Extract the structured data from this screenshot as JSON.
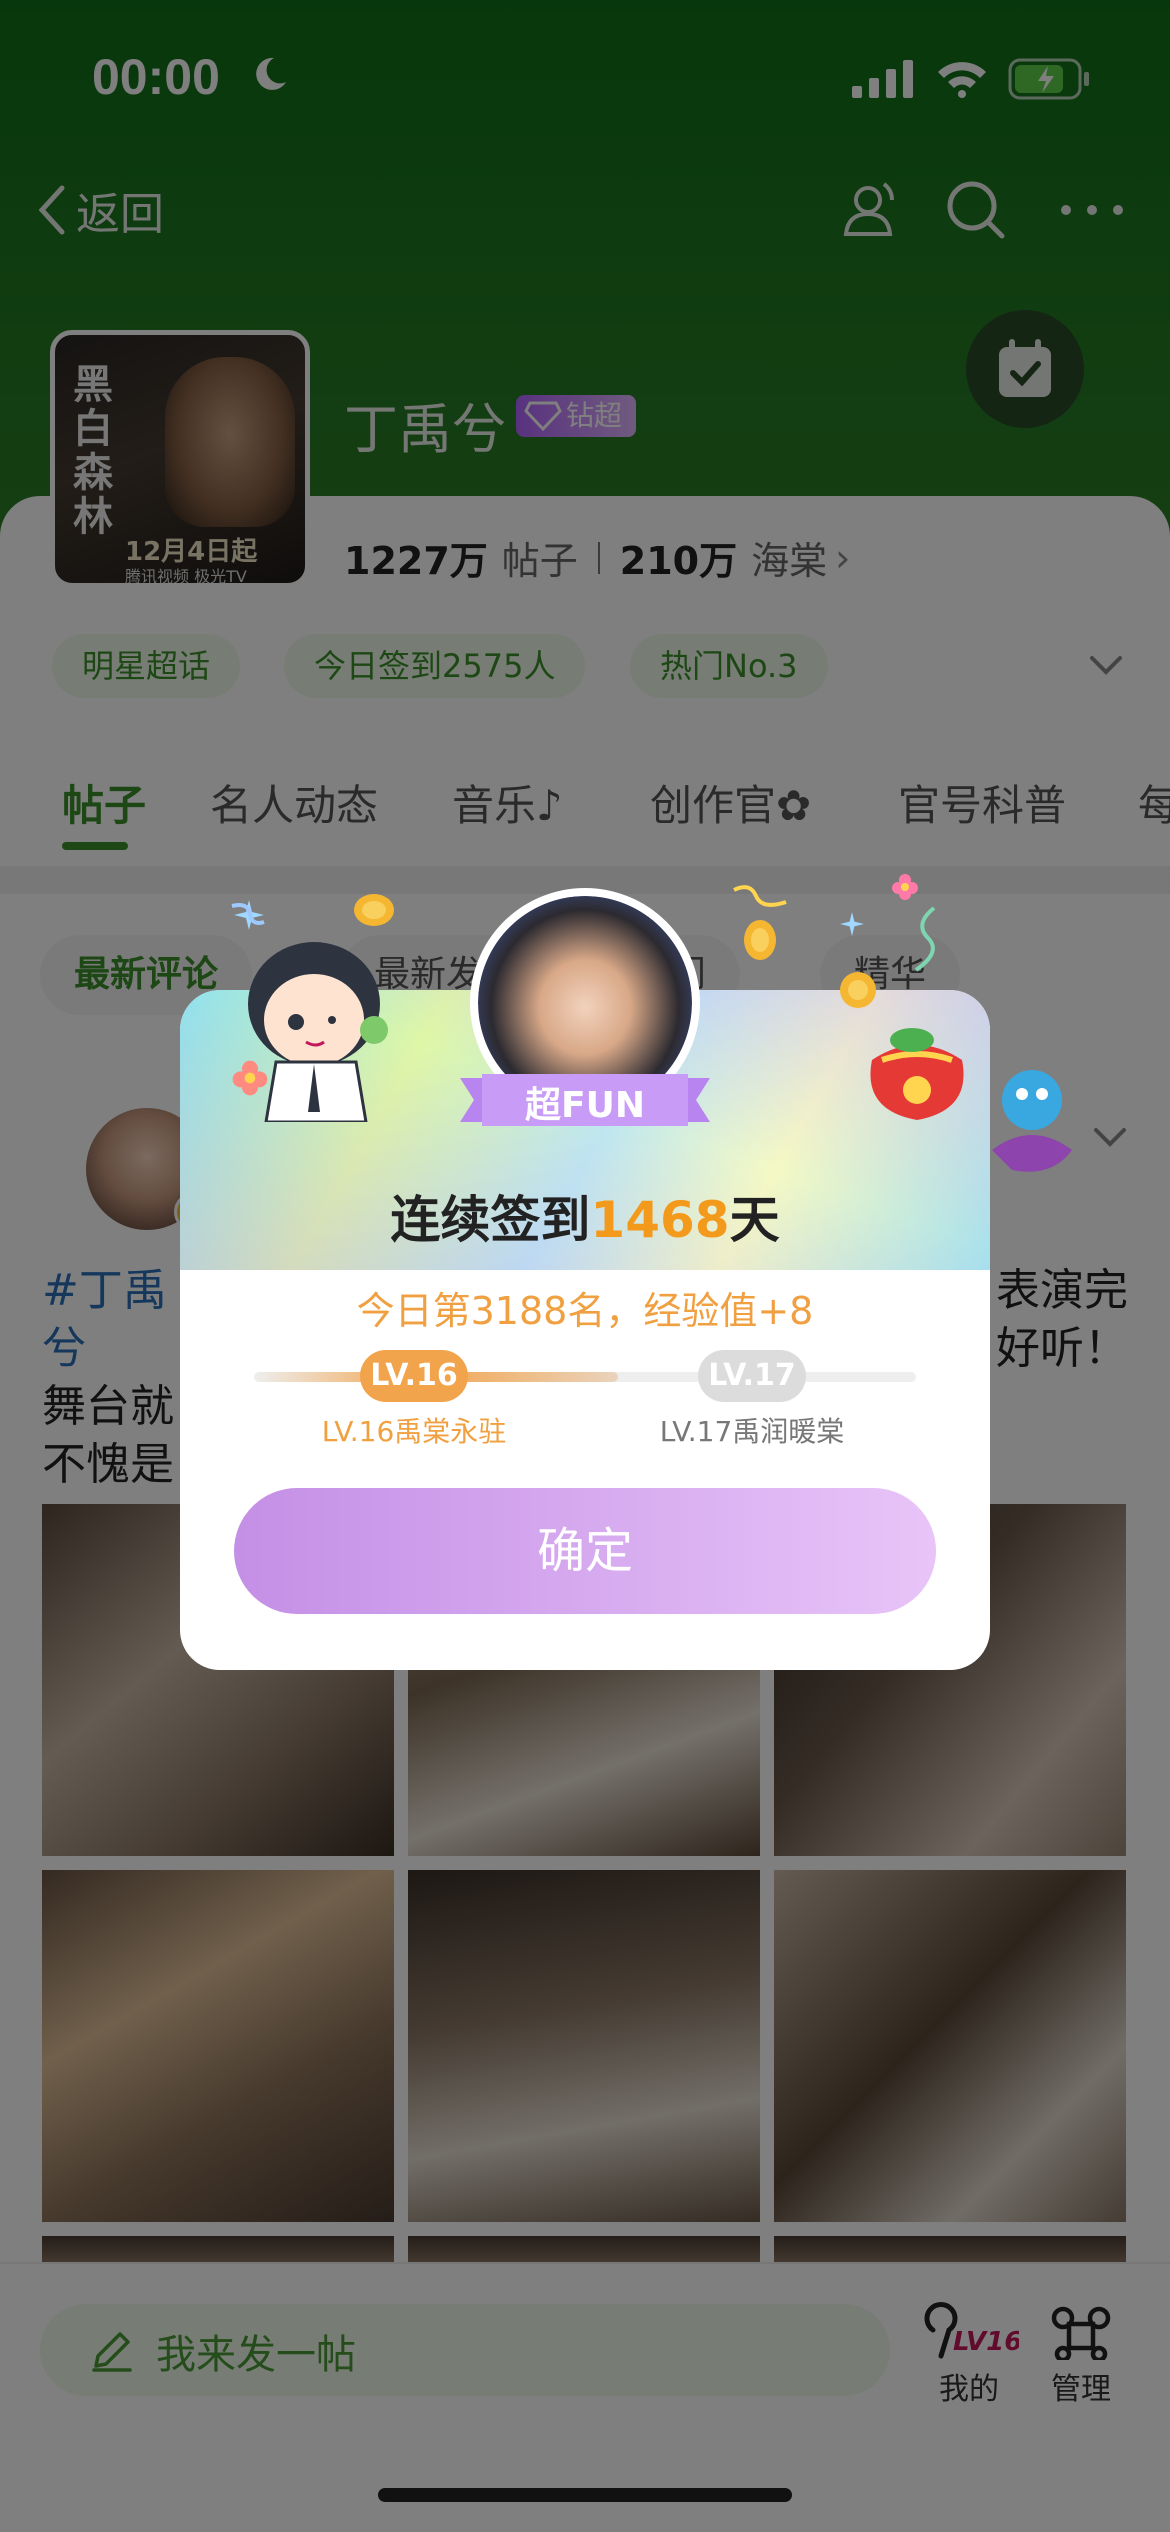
{
  "status_bar": {
    "time": "00:00"
  },
  "nav": {
    "back_label": "返回"
  },
  "profile": {
    "name": "丁禹兮",
    "badge": "钻超",
    "poster_title": "黑白森林",
    "poster_date": "12月4日起",
    "poster_sub": "腾讯视频 极光TV",
    "posts_count": "1227万",
    "posts_label": "帖子",
    "fans_count": "210万",
    "fans_label": "海棠",
    "fans_arrow": "›"
  },
  "chips": [
    "明星超话",
    "今日签到2575人",
    "热门No.3"
  ],
  "tabs": [
    "帖子",
    "名人动态",
    "音乐♪",
    "创作官✿",
    "官号科普",
    "每"
  ],
  "subtabs": [
    "最新评论",
    "最新发帖",
    "热门",
    "精华"
  ],
  "post": {
    "line1_left": "#丁禹兮",
    "line1_right": "表演完",
    "line2_left": "舞台就",
    "line2_right": "好听！",
    "line3_left": "不愧是"
  },
  "bottom_bar": {
    "compose_placeholder": "我来发一帖",
    "mine_label": "我的",
    "mine_badge": "LV16",
    "manage_label": "管理"
  },
  "modal": {
    "ribbon": "超FUN",
    "streak_prefix": "连续签到",
    "streak_days": "1468",
    "streak_suffix": "天",
    "rank_text": "今日第3188名，经验值+8",
    "current_level": "LV.16",
    "current_level_name": "LV.16禹棠永驻",
    "next_level": "LV.17",
    "next_level_name": "LV.17禹润暖棠",
    "progress": 0.55,
    "confirm": "确定"
  },
  "colors": {
    "green": "#3b8f2a",
    "orange": "#f39a1c",
    "purple": "#c48fe6"
  }
}
